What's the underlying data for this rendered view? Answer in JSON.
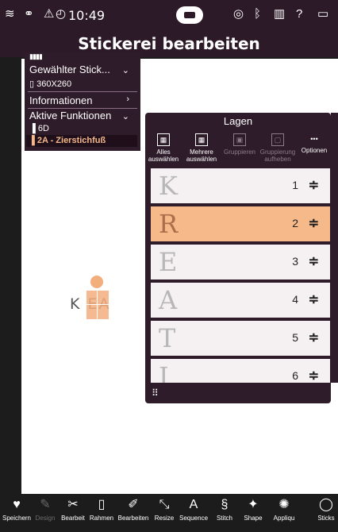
{
  "status": {
    "time": "10:49",
    "icons": [
      "wifi-icon",
      "no-sync-icon",
      "alert-icon",
      "clock-icon",
      "machine-icon",
      "bobbin-icon",
      "bluetooth-icon",
      "book-icon",
      "help-icon",
      "tablet-icon"
    ]
  },
  "title": "Stickerei bearbeiten",
  "info": {
    "design_label": "Gewählter Stick...",
    "hoop_size": "360X260",
    "informationen": "Informationen",
    "aktive": "Aktive Funktionen",
    "needle": "6D",
    "foot": "2A - Zierstichfuß"
  },
  "preview": {
    "text": "K EA"
  },
  "layers": {
    "title": "Lagen",
    "tools": [
      {
        "label": "Alles auswählen",
        "icon": "select-all-icon",
        "enabled": true
      },
      {
        "label": "Mehrere auswählen",
        "icon": "multi-select-icon",
        "enabled": true
      },
      {
        "label": "Gruppieren",
        "icon": "group-icon",
        "enabled": false
      },
      {
        "label": "Gruppierung aufheben",
        "icon": "ungroup-icon",
        "enabled": false
      },
      {
        "label": "Optionen",
        "icon": "more-icon",
        "enabled": true
      }
    ],
    "items": [
      {
        "glyph": "K",
        "num": "1",
        "selected": false
      },
      {
        "glyph": "R",
        "num": "2",
        "selected": true
      },
      {
        "glyph": "E",
        "num": "3",
        "selected": false
      },
      {
        "glyph": "A",
        "num": "4",
        "selected": false
      },
      {
        "glyph": "T",
        "num": "5",
        "selected": false
      },
      {
        "glyph": "I",
        "num": "6",
        "selected": false
      }
    ],
    "drag_glyph": "≑"
  },
  "bottom": [
    {
      "label": "Speichern",
      "icon": "heart-icon",
      "glyph": "♥",
      "enabled": true
    },
    {
      "label": "Design",
      "icon": "design-icon",
      "glyph": "✎",
      "enabled": false
    },
    {
      "label": "Bearbeit",
      "icon": "edit-icon",
      "glyph": "✂",
      "enabled": true
    },
    {
      "label": "Rahmen",
      "icon": "hoop-icon",
      "glyph": "▯",
      "enabled": true
    },
    {
      "label": "Bearbeiten",
      "icon": "edit-stitches-icon",
      "glyph": "✐",
      "enabled": true
    },
    {
      "label": "Resize",
      "icon": "resize-icon",
      "glyph": "⤡",
      "enabled": true
    },
    {
      "label": "Sequence",
      "icon": "sequence-icon",
      "glyph": "A",
      "enabled": true
    },
    {
      "label": "Stitch",
      "icon": "stitch-icon",
      "glyph": "§",
      "enabled": true
    },
    {
      "label": "Shape",
      "icon": "shape-icon",
      "glyph": "✦",
      "enabled": true
    },
    {
      "label": "Appliqu",
      "icon": "applique-icon",
      "glyph": "✺",
      "enabled": true
    },
    {
      "label": "Sticks",
      "icon": "sticks-icon",
      "glyph": "◯",
      "enabled": true
    }
  ]
}
